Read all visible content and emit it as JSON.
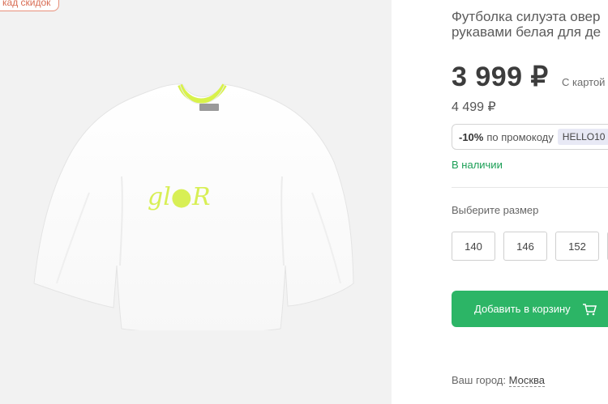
{
  "badge": "кад скидок",
  "print_text": "gl●R",
  "product": {
    "title_line1": "Футболка силуэта овер",
    "title_line2": "рукавами белая для де"
  },
  "price": {
    "current": "3 999 ₽",
    "note": "С картой",
    "old": "4 499 ₽"
  },
  "promo": {
    "discount": "-10%",
    "text": "по промокоду",
    "code": "HELLO10"
  },
  "stock": "В наличии",
  "size_label": "Выберите размер",
  "sizes": [
    "140",
    "146",
    "152"
  ],
  "cart_button": "Добавить в корзину",
  "city": {
    "label": "Ваш город:",
    "value": "Москва"
  },
  "colors": {
    "accent": "#2cb566",
    "badge": "#e8907a",
    "collar": "#d8f24a",
    "background": "#f2f2f2"
  },
  "icons": [
    "cart-icon"
  ]
}
